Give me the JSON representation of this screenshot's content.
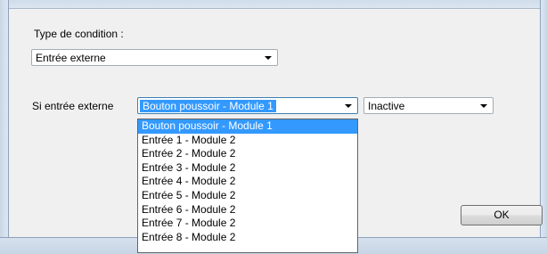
{
  "condition": {
    "type_label": "Type de condition :",
    "type_value": "Entrée externe"
  },
  "external": {
    "label": "Si entrée externe",
    "input_value": "Bouton poussoir - Module 1",
    "state_value": "Inactive"
  },
  "dropdown": {
    "items": [
      "Bouton poussoir - Module 1",
      "Entrée 1 - Module 2",
      "Entrée 2 - Module 2",
      "Entrée 3 - Module 2",
      "Entrée 4 - Module 2",
      "Entrée 5 - Module 2",
      "Entrée 6 - Module 2",
      "Entrée 7 - Module 2",
      "Entrée 8 - Module 2"
    ],
    "selected_index": 0
  },
  "buttons": {
    "ok_label": "OK"
  },
  "icons": {
    "combo_arrow": "chevron-down-icon"
  }
}
